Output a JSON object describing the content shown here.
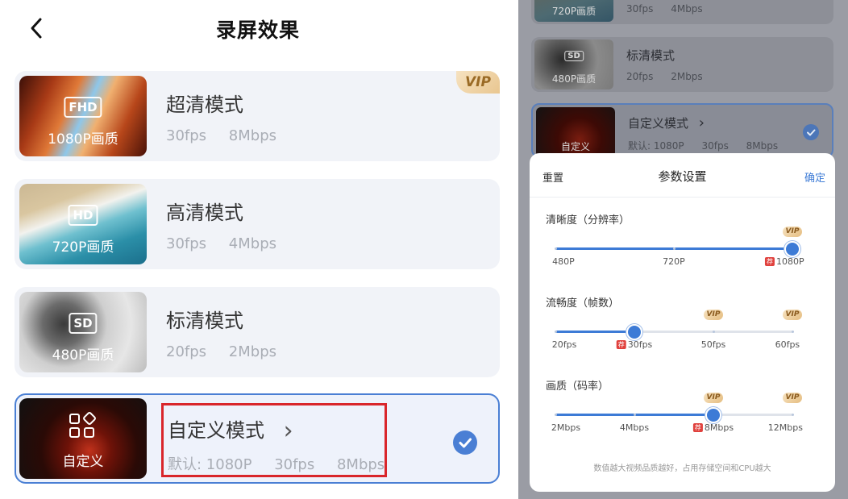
{
  "header": {
    "title": "录屏效果",
    "back_icon": "chevron-left-icon"
  },
  "modes": [
    {
      "name": "超清模式",
      "badge": "FHD",
      "quality": "1080P画质",
      "fps": "30fps",
      "bitrate": "8Mbps",
      "vip": "VIP"
    },
    {
      "name": "高清模式",
      "badge": "HD",
      "quality": "720P画质",
      "fps": "30fps",
      "bitrate": "4Mbps"
    },
    {
      "name": "标清模式",
      "badge": "SD",
      "quality": "480P画质",
      "fps": "20fps",
      "bitrate": "2Mbps"
    },
    {
      "name": "自定义模式",
      "quality": "自定义",
      "arrow": "›",
      "default_label": "默认: 1080P",
      "fps": "30fps",
      "bitrate": "8Mbps",
      "selected": true
    }
  ],
  "background_list": [
    {
      "quality": "720P画质",
      "fps": "30fps",
      "bitrate": "4Mbps"
    },
    {
      "name": "标清模式",
      "badge": "SD",
      "quality": "480P画质",
      "fps": "20fps",
      "bitrate": "2Mbps"
    },
    {
      "name": "自定义模式",
      "arrow": "›",
      "quality": "自定义",
      "default_label": "默认: 1080P",
      "fps": "30fps",
      "bitrate": "8Mbps",
      "selected": true
    }
  ],
  "sheet": {
    "reset": "重置",
    "title": "参数设置",
    "confirm": "确定",
    "rec_tag": "荐",
    "vip_tag": "VIP",
    "resolution": {
      "label": "清晰度（分辨率）",
      "options": [
        "480P",
        "720P",
        "1080P"
      ],
      "selected_index": 2,
      "vip_index": [
        2
      ],
      "recommended_index": 2
    },
    "framerate": {
      "label": "流畅度（帧数）",
      "options": [
        "20fps",
        "30fps",
        "50fps",
        "60fps"
      ],
      "selected_index": 1,
      "vip_index": [
        2,
        3
      ],
      "recommended_index": 1
    },
    "bitrate": {
      "label": "画质（码率）",
      "options": [
        "2Mbps",
        "4Mbps",
        "8Mbps",
        "12Mbps"
      ],
      "selected_index": 2,
      "vip_index": [
        2,
        3
      ],
      "recommended_index": 2
    },
    "footnote": "数值越大视频品质越好，占用存储空间和CPU越大"
  },
  "colors": {
    "accent": "#4a7fd4",
    "vip_text": "#9a6a25",
    "highlight": "#d9262b",
    "rec": "#e0413d"
  }
}
